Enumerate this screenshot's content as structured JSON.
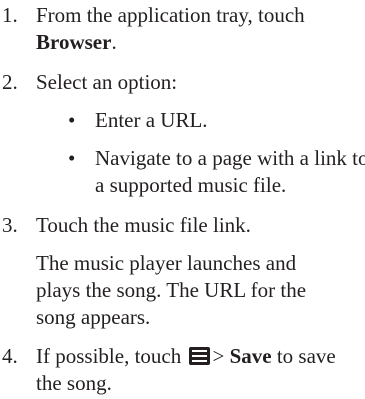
{
  "steps": [
    {
      "number": "1.",
      "lines": [
        "From the application tray, touch",
        "Browser",
        "."
      ]
    },
    {
      "number": "2.",
      "text": "Select an option:",
      "bullets": [
        {
          "symbol": "•",
          "lines": [
            "Enter a URL."
          ]
        },
        {
          "symbol": "•",
          "lines": [
            "Navigate to a page with a link to",
            "a supported music file."
          ]
        }
      ]
    },
    {
      "number": "3.",
      "text": "Touch the music file link.",
      "paragraph": [
        "The music player launches and",
        "plays the song. The URL for the",
        "song appears."
      ]
    },
    {
      "number": "4.",
      "parts": {
        "pre": "If possible, touch",
        "icon": "menu-icon",
        "sep": ">",
        "bold": "Save",
        "post": "to save"
      },
      "lines": [
        "the song."
      ]
    }
  ]
}
